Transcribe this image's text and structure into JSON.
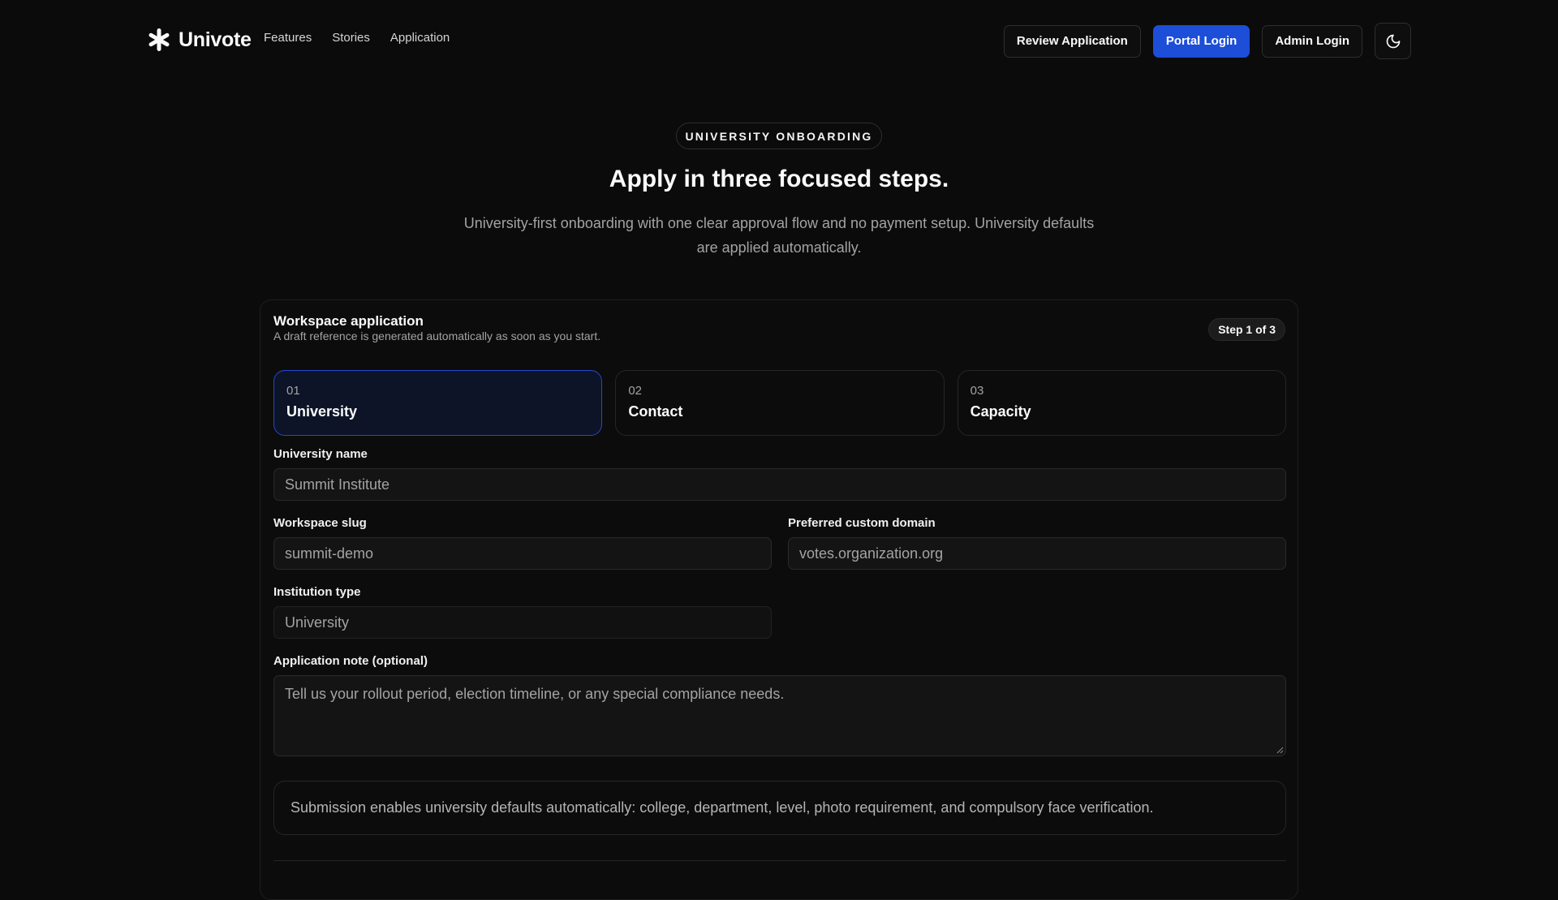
{
  "brand": {
    "name": "Univote",
    "logo_icon": "asterisk-icon"
  },
  "nav": {
    "links": [
      "Features",
      "Stories",
      "Application"
    ],
    "review_label": "Review Application",
    "portal_label": "Portal Login",
    "admin_label": "Admin Login",
    "theme_icon": "moon-icon"
  },
  "hero": {
    "eyebrow": "UNIVERSITY ONBOARDING",
    "title": "Apply in three focused steps.",
    "subtitle": "University-first onboarding with one clear approval flow and no payment setup. University defaults are applied automatically."
  },
  "card": {
    "title": "Workspace application",
    "description": "A draft reference is generated automatically as soon as you start.",
    "step_badge": "Step 1 of 3",
    "steps": [
      {
        "num": "01",
        "label": "University",
        "active": true
      },
      {
        "num": "02",
        "label": "Contact",
        "active": false
      },
      {
        "num": "03",
        "label": "Capacity",
        "active": false
      }
    ]
  },
  "form": {
    "university_name": {
      "label": "University name",
      "placeholder": "Summit Institute"
    },
    "workspace_slug": {
      "label": "Workspace slug",
      "placeholder": "summit-demo"
    },
    "custom_domain": {
      "label": "Preferred custom domain",
      "placeholder": "votes.organization.org"
    },
    "institution_type": {
      "label": "Institution type",
      "value": "University"
    },
    "application_note": {
      "label": "Application note (optional)",
      "placeholder": "Tell us your rollout period, election timeline, or any special compliance needs."
    }
  },
  "notice": "Submission enables university defaults automatically: college, department, level, photo requirement, and compulsory face verification.",
  "colors": {
    "accent": "#1d4ed8",
    "background": "#0b0b0b"
  }
}
